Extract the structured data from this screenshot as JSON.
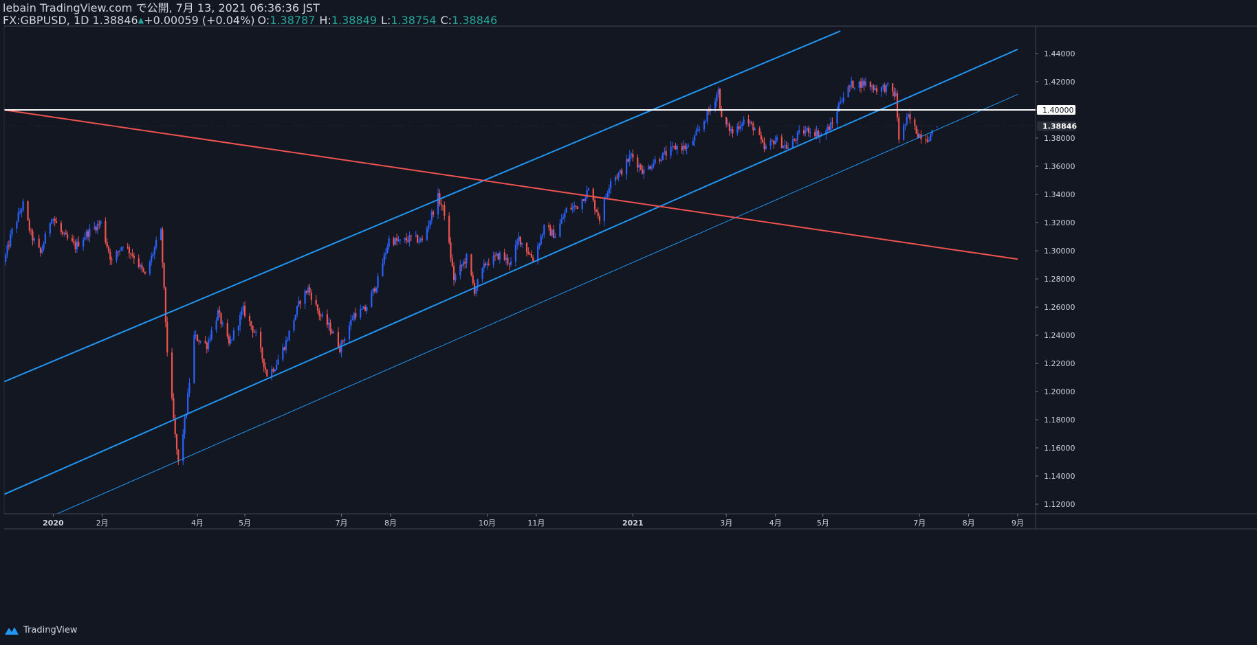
{
  "header": {
    "line1": "lebain TradingView.com で公開, 7月 13, 2021 06:36:36 JST",
    "symbol": "FX:GBPUSD, 1D",
    "last": "1.38846",
    "change": "+0.00059 (+0.04%)",
    "o_label": "O:",
    "o": "1.38787",
    "h_label": "H:",
    "h": "1.38849",
    "l_label": "L:",
    "l": "1.38754",
    "c_label": "C:",
    "c": "1.38846"
  },
  "footer": {
    "brand": "TradingView",
    "logo_icon": "tradingview-logo-icon"
  },
  "colors": {
    "background": "#131722",
    "up": "#2962ff",
    "down": "#ef5350",
    "channel": "#2196f3",
    "downtrend": "#ef5350",
    "level": "#ffffff"
  },
  "chart_data": {
    "type": "candlestick",
    "symbol": "FX:GBPUSD",
    "timeframe": "1D",
    "ylim": [
      1.11,
      1.455
    ],
    "y_ticks": [
      "1.12000",
      "1.14000",
      "1.16000",
      "1.18000",
      "1.20000",
      "1.22000",
      "1.24000",
      "1.26000",
      "1.28000",
      "1.30000",
      "1.32000",
      "1.34000",
      "1.36000",
      "1.38000",
      "1.40000",
      "1.42000",
      "1.44000"
    ],
    "x_ticks": [
      {
        "label": "2020",
        "date": "2020-01-01"
      },
      {
        "label": "2月",
        "date": "2020-02-01"
      },
      {
        "label": "4月",
        "date": "2020-04-01"
      },
      {
        "label": "5月",
        "date": "2020-05-01"
      },
      {
        "label": "7月",
        "date": "2020-07-01"
      },
      {
        "label": "8月",
        "date": "2020-08-01"
      },
      {
        "label": "10月",
        "date": "2020-10-01"
      },
      {
        "label": "11月",
        "date": "2020-11-01"
      },
      {
        "label": "2021",
        "date": "2021-01-01"
      },
      {
        "label": "3月",
        "date": "2021-03-01"
      },
      {
        "label": "4月",
        "date": "2021-04-01"
      },
      {
        "label": "5月",
        "date": "2021-05-01"
      },
      {
        "label": "7月",
        "date": "2021-07-01"
      },
      {
        "label": "8月",
        "date": "2021-08-01"
      },
      {
        "label": "9月",
        "date": "2021-09-01"
      }
    ],
    "close_series": [
      [
        "2019-12-01",
        1.292
      ],
      [
        "2019-12-06",
        1.314
      ],
      [
        "2019-12-13",
        1.333
      ],
      [
        "2019-12-18",
        1.311
      ],
      [
        "2019-12-24",
        1.298
      ],
      [
        "2019-12-31",
        1.325
      ],
      [
        "2020-01-07",
        1.311
      ],
      [
        "2020-01-15",
        1.303
      ],
      [
        "2020-01-22",
        1.312
      ],
      [
        "2020-01-31",
        1.32
      ],
      [
        "2020-02-07",
        1.292
      ],
      [
        "2020-02-14",
        1.305
      ],
      [
        "2020-02-21",
        1.296
      ],
      [
        "2020-02-28",
        1.282
      ],
      [
        "2020-03-06",
        1.305
      ],
      [
        "2020-03-09",
        1.313
      ],
      [
        "2020-03-13",
        1.229
      ],
      [
        "2020-03-18",
        1.168
      ],
      [
        "2020-03-20",
        1.149
      ],
      [
        "2020-03-25",
        1.186
      ],
      [
        "2020-03-30",
        1.239
      ],
      [
        "2020-04-07",
        1.233
      ],
      [
        "2020-04-14",
        1.256
      ],
      [
        "2020-04-21",
        1.233
      ],
      [
        "2020-04-30",
        1.258
      ],
      [
        "2020-05-08",
        1.24
      ],
      [
        "2020-05-15",
        1.212
      ],
      [
        "2020-05-20",
        1.218
      ],
      [
        "2020-05-27",
        1.235
      ],
      [
        "2020-06-05",
        1.265
      ],
      [
        "2020-06-10",
        1.273
      ],
      [
        "2020-06-17",
        1.255
      ],
      [
        "2020-06-24",
        1.245
      ],
      [
        "2020-06-30",
        1.231
      ],
      [
        "2020-07-09",
        1.255
      ],
      [
        "2020-07-16",
        1.258
      ],
      [
        "2020-07-24",
        1.279
      ],
      [
        "2020-07-31",
        1.308
      ],
      [
        "2020-08-07",
        1.306
      ],
      [
        "2020-08-14",
        1.309
      ],
      [
        "2020-08-21",
        1.307
      ],
      [
        "2020-08-31",
        1.338
      ],
      [
        "2020-09-04",
        1.327
      ],
      [
        "2020-09-10",
        1.28
      ],
      [
        "2020-09-18",
        1.295
      ],
      [
        "2020-09-23",
        1.272
      ],
      [
        "2020-09-30",
        1.291
      ],
      [
        "2020-10-09",
        1.297
      ],
      [
        "2020-10-16",
        1.291
      ],
      [
        "2020-10-21",
        1.309
      ],
      [
        "2020-10-30",
        1.294
      ],
      [
        "2020-11-06",
        1.316
      ],
      [
        "2020-11-13",
        1.311
      ],
      [
        "2020-11-20",
        1.329
      ],
      [
        "2020-11-27",
        1.332
      ],
      [
        "2020-12-04",
        1.343
      ],
      [
        "2020-12-11",
        1.323
      ],
      [
        "2020-12-18",
        1.351
      ],
      [
        "2020-12-24",
        1.355
      ],
      [
        "2020-12-31",
        1.368
      ],
      [
        "2021-01-08",
        1.356
      ],
      [
        "2021-01-15",
        1.364
      ],
      [
        "2021-01-22",
        1.369
      ],
      [
        "2021-01-29",
        1.374
      ],
      [
        "2021-02-05",
        1.373
      ],
      [
        "2021-02-12",
        1.386
      ],
      [
        "2021-02-19",
        1.401
      ],
      [
        "2021-02-24",
        1.414
      ],
      [
        "2021-02-26",
        1.393
      ],
      [
        "2021-03-05",
        1.384
      ],
      [
        "2021-03-12",
        1.393
      ],
      [
        "2021-03-19",
        1.387
      ],
      [
        "2021-03-25",
        1.372
      ],
      [
        "2021-04-01",
        1.379
      ],
      [
        "2021-04-09",
        1.373
      ],
      [
        "2021-04-16",
        1.383
      ],
      [
        "2021-04-22",
        1.386
      ],
      [
        "2021-04-30",
        1.382
      ],
      [
        "2021-05-07",
        1.39
      ],
      [
        "2021-05-12",
        1.407
      ],
      [
        "2021-05-19",
        1.418
      ],
      [
        "2021-05-28",
        1.419
      ],
      [
        "2021-06-04",
        1.415
      ],
      [
        "2021-06-11",
        1.416
      ],
      [
        "2021-06-16",
        1.41
      ],
      [
        "2021-06-18",
        1.38
      ],
      [
        "2021-06-24",
        1.395
      ],
      [
        "2021-06-30",
        1.383
      ],
      [
        "2021-07-06",
        1.38
      ],
      [
        "2021-07-09",
        1.383
      ],
      [
        "2021-07-12",
        1.38846
      ]
    ],
    "horizontal_line": {
      "price": 1.4,
      "label": "1.40000"
    },
    "last_price_label": "1.38846",
    "trendlines": [
      {
        "name": "channel-upper",
        "color": "#2196f3",
        "width": 2,
        "p1": [
          "2019-12-01",
          1.207
        ],
        "p2": [
          "2021-05-12",
          1.456
        ]
      },
      {
        "name": "channel-middle",
        "color": "#2196f3",
        "width": 2,
        "p1": [
          "2019-12-01",
          1.127
        ],
        "p2": [
          "2021-09-01",
          1.443
        ]
      },
      {
        "name": "channel-lower",
        "color": "#2196f3",
        "width": 1,
        "p1": [
          "2019-12-28",
          1.11
        ],
        "p2": [
          "2021-09-01",
          1.411
        ]
      },
      {
        "name": "downtrend",
        "color": "#ef5350",
        "width": 2,
        "p1": [
          "2019-12-01",
          1.4
        ],
        "p2": [
          "2021-09-01",
          1.294
        ]
      }
    ]
  }
}
